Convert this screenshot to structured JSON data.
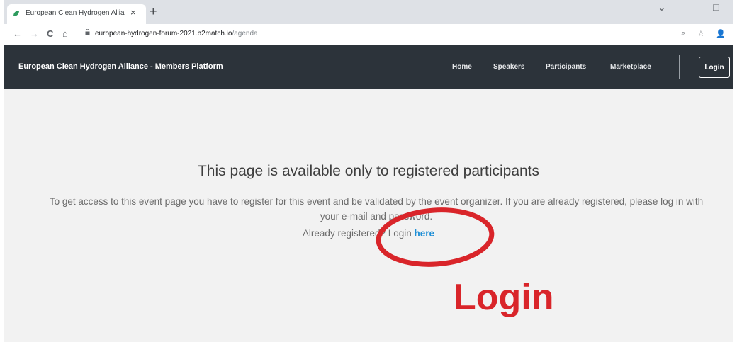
{
  "browser": {
    "tab_title": "European Clean Hydrogen Allia...",
    "tab_close": "×",
    "new_tab": "+",
    "window_controls": [
      "⌄",
      "–",
      "□"
    ],
    "nav_icons": [
      "←",
      "→",
      "C",
      "⌂"
    ],
    "url_host": "european-hydrogen-forum-2021.b2match.io",
    "url_path": "/agenda",
    "toolbar_icons": [
      "⌕",
      "☆",
      "👤"
    ]
  },
  "navbar": {
    "brand": "European Clean Hydrogen Alliance - Members Platform",
    "links": [
      "Home",
      "Speakers",
      "Participants",
      "Marketplace"
    ],
    "login_button": "Login"
  },
  "content": {
    "heading": "This page is available only to registered participants",
    "paragraph": "To get access to this event page you have to register for this event and be validated by the event organizer. If you are already registered, please log in with your e-mail and password.",
    "already_prefix": "Already registered? Login ",
    "here_link": "here"
  },
  "annotation": {
    "label": "Login",
    "color": "#d9252a"
  },
  "colors": {
    "navbar_bg": "#2c333a",
    "content_bg": "#f2f2f2",
    "link": "#1f8fd6"
  }
}
